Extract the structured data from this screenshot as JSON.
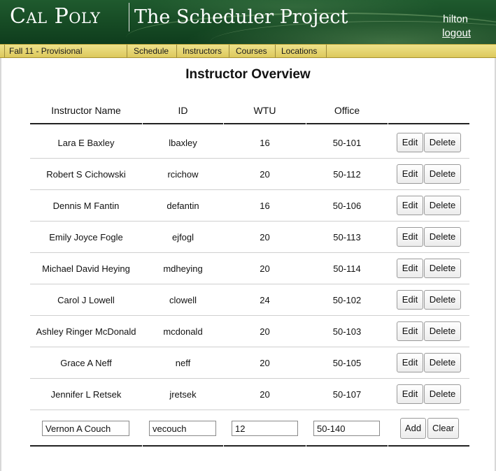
{
  "header": {
    "logo_text": "Cal Poly",
    "app_title": "The Scheduler Project",
    "user_name": "hilton",
    "logout_label": "logout"
  },
  "nav": {
    "term": "Fall 11 - Provisional",
    "items": [
      "Schedule",
      "Instructors",
      "Courses",
      "Locations"
    ]
  },
  "page": {
    "title": "Instructor Overview"
  },
  "table": {
    "columns": [
      "Instructor Name",
      "ID",
      "WTU",
      "Office"
    ],
    "rows": [
      {
        "name": "Lara E Baxley",
        "id": "lbaxley",
        "wtu": "16",
        "office": "50-101"
      },
      {
        "name": "Robert S Cichowski",
        "id": "rcichow",
        "wtu": "20",
        "office": "50-112"
      },
      {
        "name": "Dennis M Fantin",
        "id": "defantin",
        "wtu": "16",
        "office": "50-106"
      },
      {
        "name": "Emily Joyce Fogle",
        "id": "ejfogl",
        "wtu": "20",
        "office": "50-113"
      },
      {
        "name": "Michael David Heying",
        "id": "mdheying",
        "wtu": "20",
        "office": "50-114"
      },
      {
        "name": "Carol J Lowell",
        "id": "clowell",
        "wtu": "24",
        "office": "50-102"
      },
      {
        "name": "Ashley Ringer McDonald",
        "id": "mcdonald",
        "wtu": "20",
        "office": "50-103"
      },
      {
        "name": "Grace A Neff",
        "id": "neff",
        "wtu": "20",
        "office": "50-105"
      },
      {
        "name": "Jennifer L Retsek",
        "id": "jretsek",
        "wtu": "20",
        "office": "50-107"
      }
    ],
    "edit_label": "Edit",
    "delete_label": "Delete"
  },
  "add_form": {
    "name_value": "Vernon A Couch",
    "id_value": "vecouch",
    "wtu_value": "12",
    "office_value": "50-140",
    "add_label": "Add",
    "clear_label": "Clear"
  },
  "colors": {
    "header_green": "#164a24",
    "nav_gold": "#e6d675",
    "rule_dark": "#222222"
  }
}
